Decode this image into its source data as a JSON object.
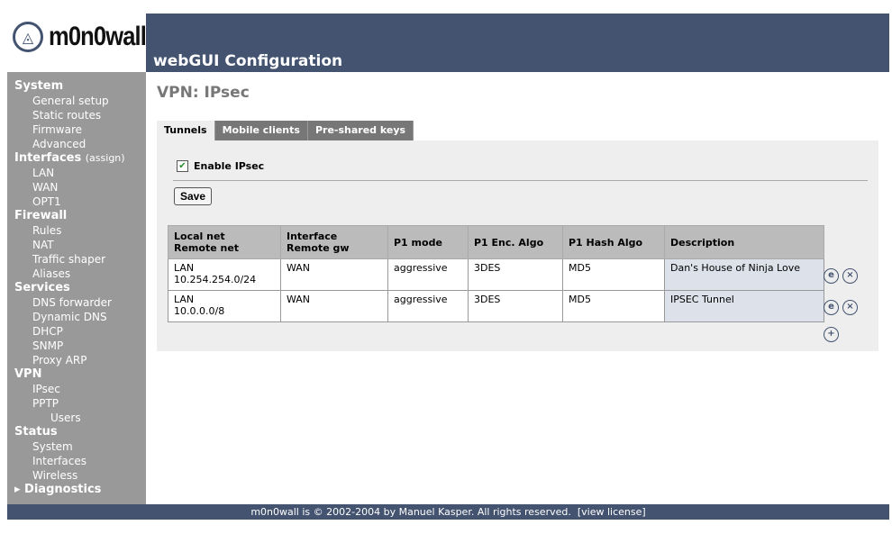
{
  "logo": {
    "text": "m0n0wall"
  },
  "header": {
    "title": "webGUI Configuration"
  },
  "sidebar": [
    {
      "label": "System",
      "type": "sec"
    },
    {
      "label": "General setup",
      "type": "it"
    },
    {
      "label": "Static routes",
      "type": "it"
    },
    {
      "label": "Firmware",
      "type": "it"
    },
    {
      "label": "Advanced",
      "type": "it"
    },
    {
      "label": "Interfaces",
      "type": "sec",
      "extra": "(assign)"
    },
    {
      "label": "LAN",
      "type": "it"
    },
    {
      "label": "WAN",
      "type": "it"
    },
    {
      "label": "OPT1",
      "type": "it"
    },
    {
      "label": "Firewall",
      "type": "sec"
    },
    {
      "label": "Rules",
      "type": "it"
    },
    {
      "label": "NAT",
      "type": "it"
    },
    {
      "label": "Traffic shaper",
      "type": "it"
    },
    {
      "label": "Aliases",
      "type": "it"
    },
    {
      "label": "Services",
      "type": "sec"
    },
    {
      "label": "DNS forwarder",
      "type": "it"
    },
    {
      "label": "Dynamic DNS",
      "type": "it"
    },
    {
      "label": "DHCP",
      "type": "it"
    },
    {
      "label": "SNMP",
      "type": "it"
    },
    {
      "label": "Proxy ARP",
      "type": "it"
    },
    {
      "label": "VPN",
      "type": "sec"
    },
    {
      "label": "IPsec",
      "type": "it"
    },
    {
      "label": "PPTP",
      "type": "it"
    },
    {
      "label": "Users",
      "type": "it2"
    },
    {
      "label": "Status",
      "type": "sec"
    },
    {
      "label": "System",
      "type": "it"
    },
    {
      "label": "Interfaces",
      "type": "it"
    },
    {
      "label": "Wireless",
      "type": "it"
    },
    {
      "label": "▸ Diagnostics",
      "type": "sec"
    }
  ],
  "page": {
    "title": "VPN: IPsec"
  },
  "tabs": [
    "Tunnels",
    "Mobile clients",
    "Pre-shared keys"
  ],
  "enable_label": "Enable IPsec",
  "enable_checked": true,
  "save_label": "Save",
  "table": {
    "headers": [
      [
        "Local net",
        "Remote net"
      ],
      [
        "Interface",
        "Remote gw"
      ],
      [
        "P1 mode"
      ],
      [
        "P1 Enc. Algo"
      ],
      [
        "P1 Hash Algo"
      ],
      [
        "Description"
      ]
    ],
    "rows": [
      [
        [
          "LAN",
          "10.254.254.0/24"
        ],
        [
          "WAN"
        ],
        [
          "aggressive"
        ],
        [
          "3DES"
        ],
        [
          "MD5"
        ],
        [
          "Dan's House of Ninja Love"
        ]
      ],
      [
        [
          "LAN",
          "10.0.0.0/8"
        ],
        [
          "WAN"
        ],
        [
          "aggressive"
        ],
        [
          "3DES"
        ],
        [
          "MD5"
        ],
        [
          "IPSEC Tunnel"
        ]
      ]
    ]
  },
  "icons": {
    "edit": "e",
    "delete": "×",
    "add": "+"
  },
  "footer": {
    "text": "m0n0wall is © 2002-2004 by Manuel Kasper. All rights reserved.",
    "link": "[view license]"
  }
}
